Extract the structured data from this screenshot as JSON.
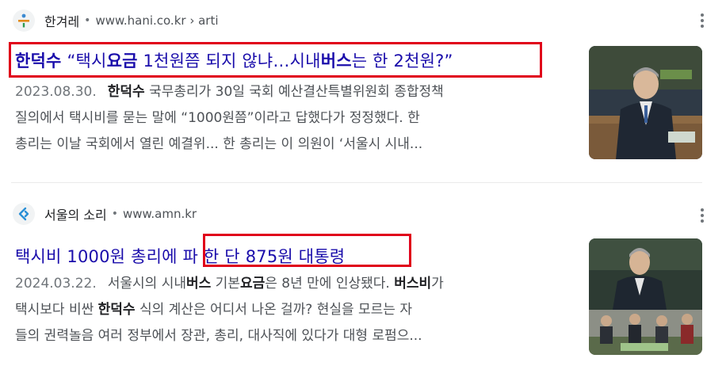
{
  "results": [
    {
      "source_name": "한겨레",
      "separator": "•",
      "url": "www.hani.co.kr › arti",
      "title_parts": [
        {
          "text": "한덕수",
          "bold": true
        },
        {
          "text": " “택시",
          "bold": false
        },
        {
          "text": "요금",
          "bold": true
        },
        {
          "text": " 1천원쯤 되지 않냐…시내",
          "bold": false
        },
        {
          "text": "버스",
          "bold": true
        },
        {
          "text": "는 한 2천원?”",
          "bold": false
        }
      ],
      "date": "2023.08.30.",
      "snippet_lines": [
        [
          {
            "text": "한덕수",
            "bold": true
          },
          {
            "text": " 국무총리가 30일 국회 예산결산특별위원회 종합정책",
            "bold": false
          }
        ],
        [
          {
            "text": "질의에서 택시비를 묻는 말에 “1000원쯤”이라고 답했다가 정정했다. 한",
            "bold": false
          }
        ],
        [
          {
            "text": "총리는 이날 국회에서 열린 예결위... 한 총리는 이 의원이 ‘서울시 시내...",
            "bold": false
          }
        ]
      ]
    },
    {
      "source_name": "서울의 소리",
      "separator": "•",
      "url": "www.amn.kr",
      "title_parts": [
        {
          "text": "택시비 1000원 총리에 파 한 단 875원 대통령",
          "bold": false
        }
      ],
      "date": "2024.03.22.",
      "snippet_lines": [
        [
          {
            "text": "서울시의 시내",
            "bold": false
          },
          {
            "text": "버스",
            "bold": true
          },
          {
            "text": " 기본",
            "bold": false
          },
          {
            "text": "요금",
            "bold": true
          },
          {
            "text": "은 8년 만에 인상됐다. ",
            "bold": false
          },
          {
            "text": "버스비",
            "bold": true
          },
          {
            "text": "가",
            "bold": false
          }
        ],
        [
          {
            "text": "택시보다 비싼 ",
            "bold": false
          },
          {
            "text": "한덕수",
            "bold": true
          },
          {
            "text": " 식의 계산은 어디서 나온 걸까? 현실을 모르는 자",
            "bold": false
          }
        ],
        [
          {
            "text": "들의 권력놀음 여러 정부에서 장관, 총리, 대사직에 있다가 대형 로펌으...",
            "bold": false
          }
        ]
      ]
    }
  ],
  "icons": {
    "hani_favicon": "hani-logo-icon",
    "amn_favicon": "amn-logo-icon",
    "menu": "more-vert-icon"
  },
  "colors": {
    "link": "#1a0dab",
    "highlight_box": "#e0001a",
    "snippet": "#4d5156"
  }
}
